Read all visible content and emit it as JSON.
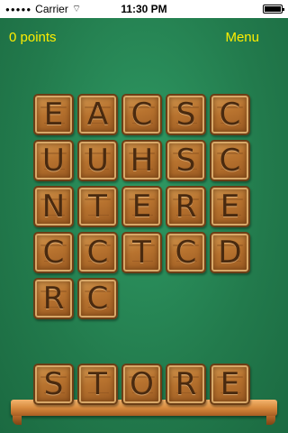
{
  "status_bar": {
    "carrier": "Carrier",
    "time": "11:30 PM",
    "signal_icon": "signal-dots",
    "wifi_icon": "wifi-icon",
    "battery_icon": "battery-full"
  },
  "header": {
    "points_label": "0 points",
    "menu_label": "Menu"
  },
  "board": {
    "rows": [
      [
        "E",
        "A",
        "C",
        "S",
        "C"
      ],
      [
        "U",
        "U",
        "H",
        "S",
        "C"
      ],
      [
        "N",
        "T",
        "E",
        "R",
        "E"
      ],
      [
        "C",
        "C",
        "T",
        "C",
        "D"
      ],
      [
        "R",
        "C"
      ]
    ]
  },
  "shelf": {
    "word": [
      "S",
      "T",
      "O",
      "R",
      "E"
    ]
  },
  "colors": {
    "background": "#227a4c",
    "header_text": "#ffee00",
    "tile_wood": "#b8732f",
    "tile_letter": "#4a2a0f"
  }
}
